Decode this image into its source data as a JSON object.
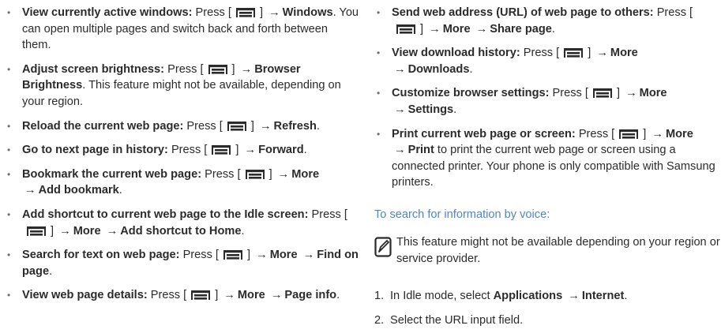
{
  "left_items": [
    {
      "label": "View currently active windows:",
      "parts": [
        {
          "t": "Press ["
        },
        {
          "k": "menu"
        },
        {
          "t": "] "
        },
        {
          "a": 1
        },
        {
          "b": "Windows"
        },
        {
          "t": ". You can open multiple pages and switch back and forth between them."
        }
      ]
    },
    {
      "label": "Adjust screen brightness:",
      "parts": [
        {
          "t": "Press ["
        },
        {
          "k": "menu"
        },
        {
          "t": "] "
        },
        {
          "a": 1
        },
        {
          "b": "Browser Brightness"
        },
        {
          "t": ". This feature might not be available, depending on your region."
        }
      ]
    },
    {
      "label": "Reload the current web page:",
      "parts": [
        {
          "t": "Press ["
        },
        {
          "k": "menu"
        },
        {
          "t": "] "
        },
        {
          "a": 1
        },
        {
          "b": "Refresh"
        },
        {
          "t": "."
        }
      ]
    },
    {
      "label": "Go to next page in history:",
      "parts": [
        {
          "t": "Press ["
        },
        {
          "k": "menu"
        },
        {
          "t": "] "
        },
        {
          "a": 1
        },
        {
          "b": "Forward"
        },
        {
          "t": "."
        }
      ]
    },
    {
      "label": "Bookmark the current web page:",
      "parts": [
        {
          "t": "Press ["
        },
        {
          "k": "menu"
        },
        {
          "t": "] "
        },
        {
          "a": 1
        },
        {
          "b": "More"
        },
        {
          "t": " "
        },
        {
          "a": 1
        },
        {
          "b": "Add bookmark"
        },
        {
          "t": "."
        }
      ]
    },
    {
      "label": "Add shortcut to current web page to the Idle screen:",
      "parts": [
        {
          "t": "Press ["
        },
        {
          "k": "menu"
        },
        {
          "t": "] "
        },
        {
          "a": 1
        },
        {
          "b": "More"
        },
        {
          "t": " "
        },
        {
          "a": 1
        },
        {
          "b": "Add shortcut to Home"
        },
        {
          "t": "."
        }
      ]
    },
    {
      "label": "Search for text on web page:",
      "parts": [
        {
          "t": "Press ["
        },
        {
          "k": "menu"
        },
        {
          "t": "] "
        },
        {
          "a": 1
        },
        {
          "b": "More"
        },
        {
          "t": " "
        },
        {
          "a": 1
        },
        {
          "b": "Find on page"
        },
        {
          "t": "."
        }
      ]
    },
    {
      "label": "View web page details:",
      "parts": [
        {
          "t": "Press ["
        },
        {
          "k": "menu"
        },
        {
          "t": "] "
        },
        {
          "a": 1
        },
        {
          "b": "More"
        },
        {
          "t": " "
        },
        {
          "a": 1
        },
        {
          "b": "Page info"
        },
        {
          "t": "."
        }
      ]
    }
  ],
  "right_items": [
    {
      "label": "Send web address (URL) of web page to others:",
      "parts": [
        {
          "t": "Press ["
        },
        {
          "k": "menu"
        },
        {
          "t": "] "
        },
        {
          "a": 1
        },
        {
          "b": "More"
        },
        {
          "t": " "
        },
        {
          "a": 1
        },
        {
          "b": "Share page"
        },
        {
          "t": "."
        }
      ]
    },
    {
      "label": "View download history:",
      "parts": [
        {
          "t": "Press ["
        },
        {
          "k": "menu"
        },
        {
          "t": "] "
        },
        {
          "a": 1
        },
        {
          "b": "More"
        },
        {
          "t": " "
        },
        {
          "a": 1
        },
        {
          "b": "Downloads"
        },
        {
          "t": "."
        }
      ]
    },
    {
      "label": "Customize browser settings:",
      "parts": [
        {
          "t": "Press ["
        },
        {
          "k": "menu"
        },
        {
          "t": "] "
        },
        {
          "a": 1
        },
        {
          "b": "More"
        },
        {
          "t": " "
        },
        {
          "a": 1
        },
        {
          "b": "Settings"
        },
        {
          "t": "."
        }
      ]
    },
    {
      "label": "Print current web page or screen:",
      "parts": [
        {
          "t": "Press ["
        },
        {
          "k": "menu"
        },
        {
          "t": "] "
        },
        {
          "a": 1
        },
        {
          "b": "More"
        },
        {
          "t": " "
        },
        {
          "a": 1
        },
        {
          "b": "Print"
        },
        {
          "t": " to print the current web page or screen using a connected printer. Your phone is only compatible with Samsung printers."
        }
      ]
    }
  ],
  "section_heading": "To search for information by voice:",
  "note_text": "This feature might not be available depending on your region or service provider.",
  "steps": [
    {
      "num": "1.",
      "parts": [
        {
          "t": "In Idle mode, select "
        },
        {
          "b": "Applications"
        },
        {
          "t": " "
        },
        {
          "a": 1
        },
        {
          "b": "Internet"
        },
        {
          "t": "."
        }
      ]
    },
    {
      "num": "2.",
      "parts": [
        {
          "t": "Select the URL input field."
        }
      ]
    }
  ],
  "arrow_glyph": "→",
  "icons": {
    "menu_key": "menu-key-icon",
    "note": "note-pencil-icon"
  },
  "colors": {
    "heading": "#4f86c6",
    "text": "#2b2b2b"
  }
}
